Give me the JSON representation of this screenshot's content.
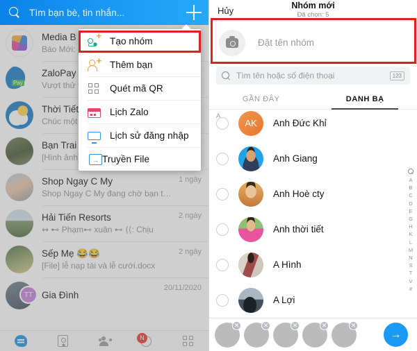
{
  "left": {
    "search": {
      "placeholder": "Tìm bạn bè, tin nhắn...",
      "icon": "search-icon"
    },
    "add_icon": "plus-icon",
    "chats": [
      {
        "name": "Media B",
        "snippet": "Báo Mới:",
        "time": ""
      },
      {
        "name": "ZaloPay",
        "snippet": "Vượt thử t",
        "time": ""
      },
      {
        "name": "Thời Tiết",
        "snippet": "Chúc một",
        "time": ""
      },
      {
        "name": "Bạn Trai S",
        "snippet": "[Hình ảnh]",
        "time": ""
      },
      {
        "name": "Shop Ngay C My",
        "snippet": "Shop Ngay C My đang chờ bạn trả lời tin nh...",
        "time": "1 ngày"
      },
      {
        "name": "Hải Tiến Resorts",
        "snippet": "↭ ⊷ Phạm⊷ xuân ⊷ ⟨⟨: Chịu",
        "time": "2 ngày"
      },
      {
        "name": "Sếp Mẹ 😂😂",
        "snippet": "[File] lễ nạp tài và lễ cưới.docx",
        "time": "2 ngày"
      },
      {
        "name": "Gia Đình",
        "snippet": "",
        "time": "20/11/2020",
        "badge": "TT"
      }
    ],
    "nav": [
      {
        "name": "tin-nhan",
        "icon": "chat-icon",
        "active": true
      },
      {
        "name": "danh-ba",
        "icon": "contact-card-icon",
        "active": false
      },
      {
        "name": "nhom",
        "icon": "group-icon",
        "active": false
      },
      {
        "name": "nhat-ky",
        "icon": "clock-icon",
        "active": false,
        "badge": "N"
      },
      {
        "name": "them",
        "icon": "grid-icon",
        "active": false
      }
    ]
  },
  "menu": {
    "items": [
      {
        "label": "Tạo nhóm",
        "icon": "new-group-icon",
        "highlighted": true
      },
      {
        "label": "Thêm bạn",
        "icon": "add-friend-icon",
        "highlighted": false
      },
      {
        "label": "Quét mã QR",
        "icon": "qr-code-icon",
        "highlighted": false
      },
      {
        "label": "Lịch Zalo",
        "icon": "calendar-icon",
        "highlighted": false
      },
      {
        "label": "Lịch sử đăng nhập",
        "icon": "monitor-icon",
        "highlighted": false
      },
      {
        "label": "Truyền File",
        "icon": "file-transfer-icon",
        "highlighted": false
      }
    ]
  },
  "right": {
    "header": {
      "cancel": "Hủy",
      "title": "Nhóm mới",
      "subtitle": "Đã chọn: 5"
    },
    "group_name": {
      "placeholder": "Đặt tên nhóm",
      "icon": "camera-icon"
    },
    "search": {
      "placeholder": "Tìm tên hoặc số điện thoại",
      "icon": "search-icon",
      "keypad_label": "123"
    },
    "tabs": [
      {
        "label": "GẦN ĐÂY",
        "active": false
      },
      {
        "label": "DANH BẠ",
        "active": true
      }
    ],
    "section_letter": "A",
    "contacts": [
      {
        "name": "Anh Đức Khỉ",
        "initials": "AK",
        "avatar_type": "initials",
        "checked": false
      },
      {
        "name": "Anh Giang",
        "initials": "",
        "avatar_type": "photo-blue",
        "checked": false
      },
      {
        "name": "Anh Hoè cty",
        "initials": "",
        "avatar_type": "photo-warm",
        "checked": false
      },
      {
        "name": "Anh thời tiết",
        "initials": "",
        "avatar_type": "photo-pink",
        "checked": false
      },
      {
        "name": "A Hình",
        "initials": "",
        "avatar_type": "photo-dark",
        "checked": false
      },
      {
        "name": "A Lợi",
        "initials": "",
        "avatar_type": "photo-car",
        "checked": false
      }
    ],
    "alpha_index": [
      "A",
      "B",
      "C",
      "D",
      "E",
      "G",
      "H",
      "K",
      "L",
      "M",
      "N",
      "S",
      "T",
      "V",
      "#"
    ],
    "selected": [
      {
        "label": "selected-1"
      },
      {
        "label": "selected-2"
      },
      {
        "label": "selected-3"
      },
      {
        "label": "selected-4"
      },
      {
        "label": "selected-5"
      }
    ],
    "send_label": "→"
  },
  "colors": {
    "header_blue": "#1b9af5",
    "accent_red": "#e02020",
    "send_blue": "#1b9af5"
  }
}
